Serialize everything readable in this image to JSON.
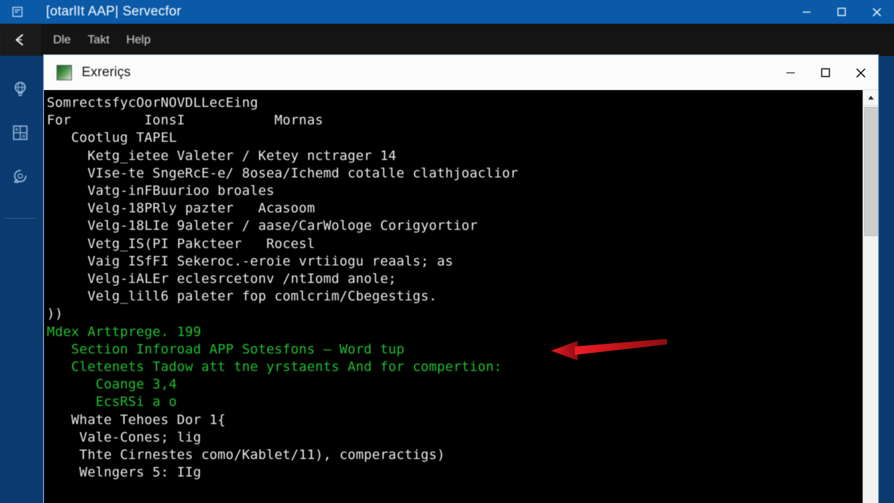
{
  "window": {
    "outer": {
      "title": "[otarlIt AAP| Servecfor",
      "app_icon": "app-icon",
      "controls": [
        {
          "name": "minimize",
          "glyph": "minimize-icon"
        },
        {
          "name": "maximize",
          "glyph": "maximize-icon"
        },
        {
          "name": "close",
          "glyph": "close-icon"
        }
      ]
    },
    "inner": {
      "title": "Exreriçs",
      "app_icon": "terminal-app-icon",
      "controls": [
        {
          "name": "minimize",
          "glyph": "minimize-icon"
        },
        {
          "name": "maximize",
          "glyph": "maximize-icon"
        },
        {
          "name": "close",
          "glyph": "close-icon"
        }
      ]
    }
  },
  "menubar": {
    "back_glyph": "back-arrow-icon",
    "items": [
      {
        "label": "Dle"
      },
      {
        "label": "Takt"
      },
      {
        "label": "Help"
      }
    ]
  },
  "sidebar": {
    "background_color": "#0a3a70",
    "icons": [
      {
        "name": "globe-lightbulb-icon"
      },
      {
        "name": "grid-table-icon"
      },
      {
        "name": "refresh-circle-icon"
      }
    ]
  },
  "terminal": {
    "background_color": "#000000",
    "text_color": "#e8e8e8",
    "green_color": "#1fbf2e",
    "lines": [
      {
        "color": "white",
        "text": "SomrectsfycOorNOVDLLecEing"
      },
      {
        "color": "white",
        "text": "For         IonsI           Mornas"
      },
      {
        "color": "white",
        "text": "   Cootlug TAPEL"
      },
      {
        "color": "white",
        "text": "     Ketg_ietee Valeter / Ketey nctrager 14"
      },
      {
        "color": "white",
        "text": "     VIse-te SngeRcE-e/ 8osea/Ichemd cotalle clathjoaclior"
      },
      {
        "color": "white",
        "text": "     Vatg-inFBuurioo broales"
      },
      {
        "color": "white",
        "text": "     Velg-18PRly pazter   Acasoom"
      },
      {
        "color": "white",
        "text": "     Velg-18LIe 9aleter / aase/CarWologe Corigyortior"
      },
      {
        "color": "white",
        "text": "     Vetg_IS(PI Pakcteer   Rocesl"
      },
      {
        "color": "white",
        "text": "     Vaig ISfFI Sekeroc.-eroie vrtiiogu reaals; as"
      },
      {
        "color": "white",
        "text": "     Velg-iALEr eclesrcetonv /ntIomd anole;"
      },
      {
        "color": "white",
        "text": "     Velg_lill6 paleter fop comlcrim/Cbegestigs."
      },
      {
        "color": "white",
        "text": "))"
      },
      {
        "color": "green",
        "text": "Mdex Arttprege. 199"
      },
      {
        "color": "green",
        "text": "   Section Inforoad APP Sotesfons — Word tup"
      },
      {
        "color": "green",
        "text": "   Cletenets Tadow att tne yrstaents And for compertion:"
      },
      {
        "color": "green",
        "text": "      Coange 3,4"
      },
      {
        "color": "green",
        "text": "      EcsRSi a o"
      },
      {
        "color": "white",
        "text": "   Whate Tehoes Dor 1{"
      },
      {
        "color": "white",
        "text": "    Vale-Cones; lig"
      },
      {
        "color": "white",
        "text": "    Thte Cirnestes como/Kablet/11), comperactigs)"
      },
      {
        "color": "white",
        "text": "    Welngers 5: IIg"
      }
    ]
  },
  "scrollbar": {
    "up_arrow": "scroll-up-arrow-icon",
    "thumb": "scroll-thumb"
  },
  "annotation": {
    "arrow_color": "#d41219",
    "direction": "left",
    "name": "red-pointer-arrow"
  }
}
